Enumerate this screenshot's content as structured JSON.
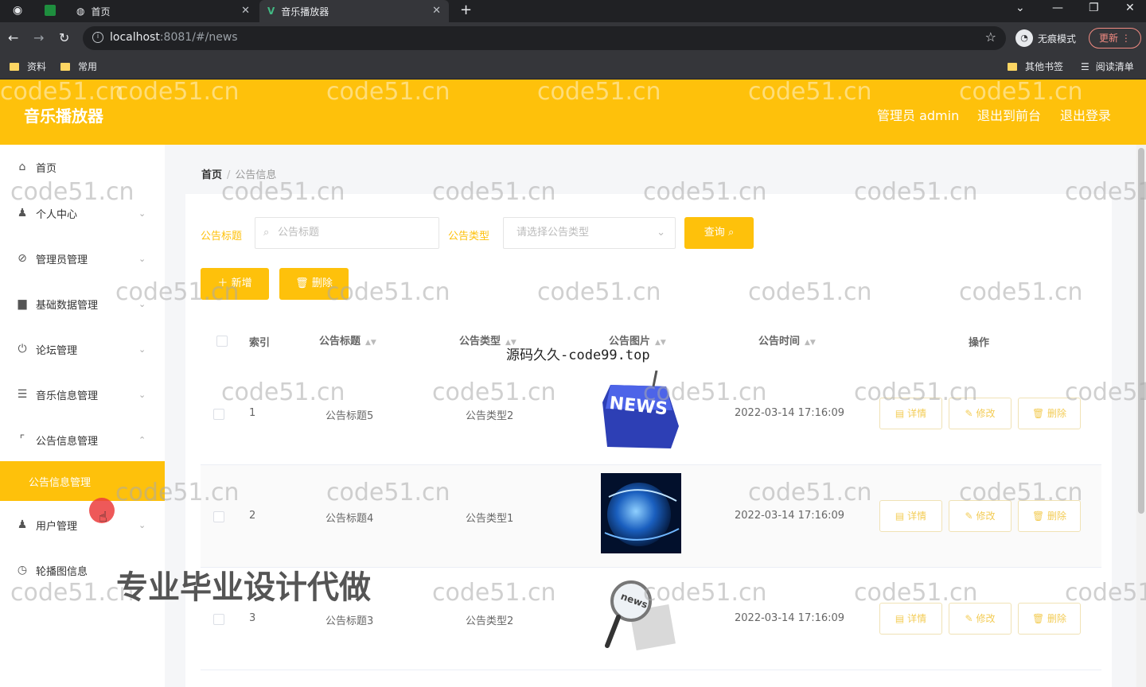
{
  "browser": {
    "tabs": [
      {
        "label": "首页"
      },
      {
        "label": "音乐播放器"
      }
    ],
    "url_host": "localhost",
    "url_rest": ":8081/#/news",
    "incognito_label": "无痕模式",
    "update_label": "更新",
    "bookmarks": [
      "资料",
      "常用"
    ],
    "bookmarks_right": [
      "其他书签",
      "阅读清单"
    ]
  },
  "header": {
    "title": "音乐播放器",
    "user": "管理员 admin",
    "back_to_front": "退出到前台",
    "logout": "退出登录"
  },
  "sidebar": {
    "items": [
      {
        "label": "首页",
        "icon": "home-icon"
      },
      {
        "label": "个人中心",
        "icon": "user-icon"
      },
      {
        "label": "管理员管理",
        "icon": "compass-icon"
      },
      {
        "label": "基础数据管理",
        "icon": "data-icon"
      },
      {
        "label": "论坛管理",
        "icon": "power-icon"
      },
      {
        "label": "音乐信息管理",
        "icon": "list-icon"
      },
      {
        "label": "公告信息管理",
        "icon": "crop-icon"
      },
      {
        "label": "用户管理",
        "icon": "user-icon"
      },
      {
        "label": "轮播图信息",
        "icon": "clock-icon"
      }
    ],
    "active_sub": "公告信息管理"
  },
  "breadcrumb": {
    "home": "首页",
    "current": "公告信息"
  },
  "filters": {
    "title_label": "公告标题",
    "title_placeholder": "公告标题",
    "type_label": "公告类型",
    "type_placeholder": "请选择公告类型",
    "query_button": "查询"
  },
  "actions": {
    "add": "新增",
    "delete": "删除"
  },
  "table": {
    "columns": [
      "索引",
      "公告标题",
      "公告类型",
      "公告图片",
      "公告时间",
      "操作"
    ],
    "rows": [
      {
        "index": "1",
        "title": "公告标题5",
        "type": "公告类型2",
        "time": "2022-03-14 17:16:09",
        "image": "news-keyboard-image"
      },
      {
        "index": "2",
        "title": "公告标题4",
        "type": "公告类型1",
        "time": "2022-03-14 17:16:09",
        "image": "globe-image"
      },
      {
        "index": "3",
        "title": "公告标题3",
        "type": "公告类型2",
        "time": "2022-03-14 17:16:09",
        "image": "magnifier-news-image"
      }
    ],
    "row_actions": {
      "detail": "详情",
      "edit": "修改",
      "delete": "删除"
    }
  },
  "watermarks": {
    "site": "code51.cn",
    "overlay1": "源码久久-code99.top",
    "overlay2": "专业毕业设计代做"
  },
  "colors": {
    "accent": "#fec10b",
    "chrome": "#202124"
  }
}
